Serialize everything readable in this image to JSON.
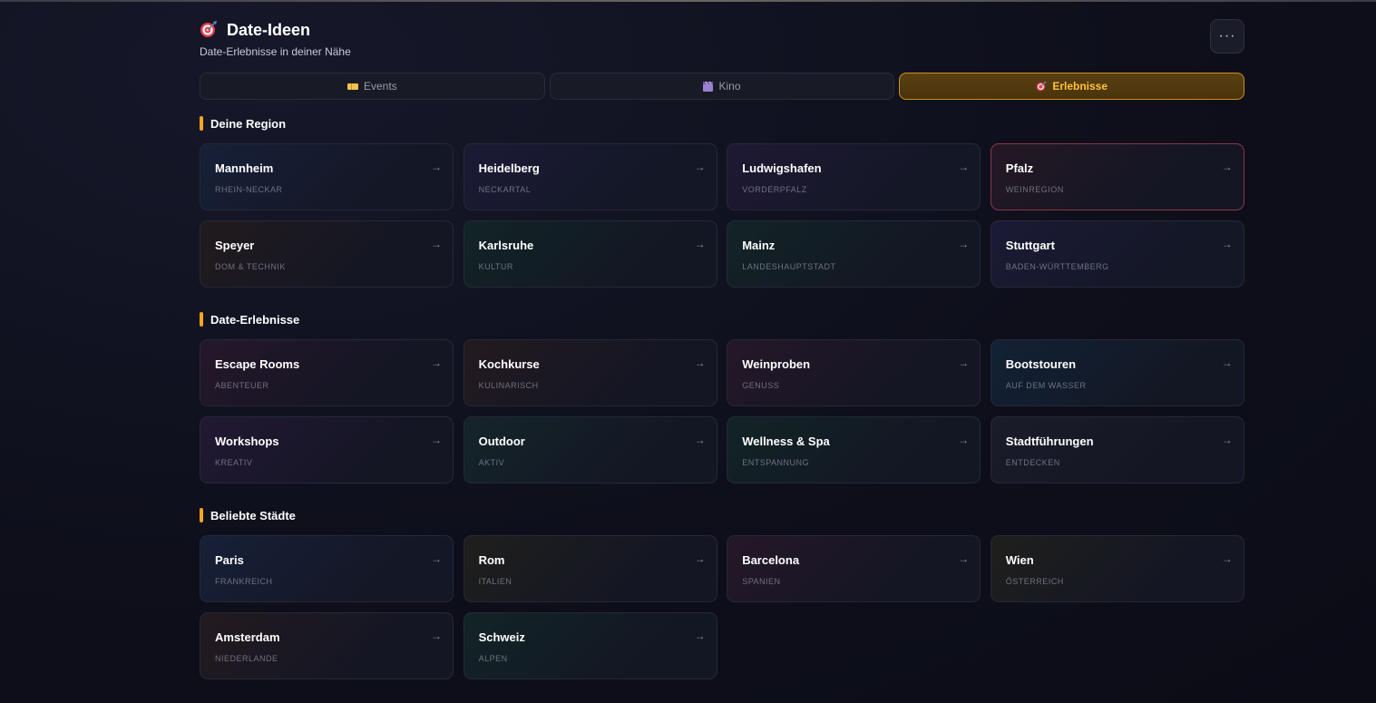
{
  "header": {
    "title": "Date-Ideen",
    "subtitle": "Date-Erlebnisse in deiner Nähe",
    "title_icon": "target-icon",
    "more_label": "···"
  },
  "tabs": [
    {
      "label": "Events",
      "icon": "ticket-icon",
      "active": false
    },
    {
      "label": "Kino",
      "icon": "clapperboard-icon",
      "active": false
    },
    {
      "label": "Erlebnisse",
      "icon": "target-icon",
      "active": true
    }
  ],
  "sections": [
    {
      "title": "Deine Region",
      "cards": [
        {
          "name": "Mannheim",
          "sub": "RHEIN-NECKAR",
          "tone": "blue"
        },
        {
          "name": "Heidelberg",
          "sub": "NECKARTAL",
          "tone": "indigo"
        },
        {
          "name": "Ludwigshafen",
          "sub": "VORDERPFALZ",
          "tone": "purple"
        },
        {
          "name": "Pfalz",
          "sub": "WEINREGION",
          "tone": "red"
        },
        {
          "name": "Speyer",
          "sub": "DOM & TECHNIK",
          "tone": "brown"
        },
        {
          "name": "Karlsruhe",
          "sub": "KULTUR",
          "tone": "teal"
        },
        {
          "name": "Mainz",
          "sub": "LANDESHAUPTSTADT",
          "tone": "teal"
        },
        {
          "name": "Stuttgart",
          "sub": "BADEN-WÜRTTEMBERG",
          "tone": "indigo"
        }
      ]
    },
    {
      "title": "Date-Erlebnisse",
      "cards": [
        {
          "name": "Escape Rooms",
          "sub": "ABENTEUER",
          "tone": "magenta"
        },
        {
          "name": "Kochkurse",
          "sub": "KULINARISCH",
          "tone": "rust"
        },
        {
          "name": "Weinproben",
          "sub": "GENUSS",
          "tone": "wine"
        },
        {
          "name": "Bootstouren",
          "sub": "AUF DEM WASSER",
          "tone": "navy"
        },
        {
          "name": "Workshops",
          "sub": "KREATIV",
          "tone": "violet"
        },
        {
          "name": "Outdoor",
          "sub": "AKTIV",
          "tone": "green"
        },
        {
          "name": "Wellness & Spa",
          "sub": "ENTSPANNUNG",
          "tone": "teal"
        },
        {
          "name": "Stadtführungen",
          "sub": "ENTDECKEN",
          "tone": "slate"
        }
      ]
    },
    {
      "title": "Beliebte Städte",
      "cards": [
        {
          "name": "Paris",
          "sub": "FRANKREICH",
          "tone": "blue"
        },
        {
          "name": "Rom",
          "sub": "ITALIEN",
          "tone": "olive"
        },
        {
          "name": "Barcelona",
          "sub": "SPANIEN",
          "tone": "wine"
        },
        {
          "name": "Wien",
          "sub": "ÖSTERREICH",
          "tone": "olive"
        },
        {
          "name": "Amsterdam",
          "sub": "NIEDERLANDE",
          "tone": "rust"
        },
        {
          "name": "Schweiz",
          "sub": "ALPEN",
          "tone": "teal"
        }
      ]
    }
  ],
  "arrow_glyph": "→",
  "colors": {
    "accent": "#f5a623",
    "active_tab_bg": "#4f380f",
    "active_tab_border": "#c8901f",
    "active_tab_text": "#ffc23a",
    "highlight_border": "#8a3645",
    "background": "#0e0f1b"
  }
}
